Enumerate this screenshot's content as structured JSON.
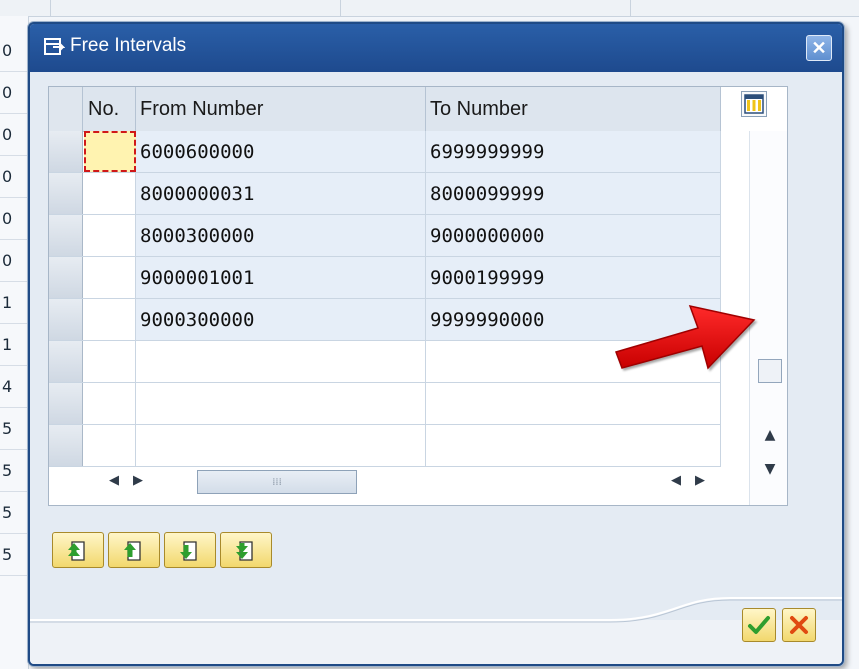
{
  "background": {
    "left_column_values": [
      "0",
      "0",
      "0",
      "0",
      "0",
      "0",
      "1",
      "1",
      "4",
      "5",
      "5",
      "5",
      "5"
    ]
  },
  "dialog": {
    "title": "Free Intervals",
    "close_icon": "close-icon",
    "title_icon": "window-icon"
  },
  "table": {
    "columns": {
      "no": "No.",
      "from": "From Number",
      "to": "To Number"
    },
    "rows": [
      {
        "from": "6000600000",
        "to": "6999999999"
      },
      {
        "from": "8000000031",
        "to": "8000099999"
      },
      {
        "from": "8000300000",
        "to": "9000000000"
      },
      {
        "from": "9000001001",
        "to": "9000199999"
      },
      {
        "from": "9000300000",
        "to": "9999990000"
      },
      {
        "from": "",
        "to": ""
      },
      {
        "from": "",
        "to": ""
      },
      {
        "from": "",
        "to": ""
      }
    ],
    "settings_icon": "column-settings-icon"
  },
  "toolbar": {
    "buttons": [
      {
        "icon": "first-page-icon"
      },
      {
        "icon": "previous-page-icon"
      },
      {
        "icon": "next-page-icon"
      },
      {
        "icon": "last-page-icon"
      }
    ]
  },
  "footer": {
    "ok_icon": "checkmark-icon",
    "cancel_icon": "cancel-icon"
  },
  "colors": {
    "title_bar": "#1e4a8e",
    "arrow": "#e00000",
    "button_yellow": "#f2d86d"
  }
}
